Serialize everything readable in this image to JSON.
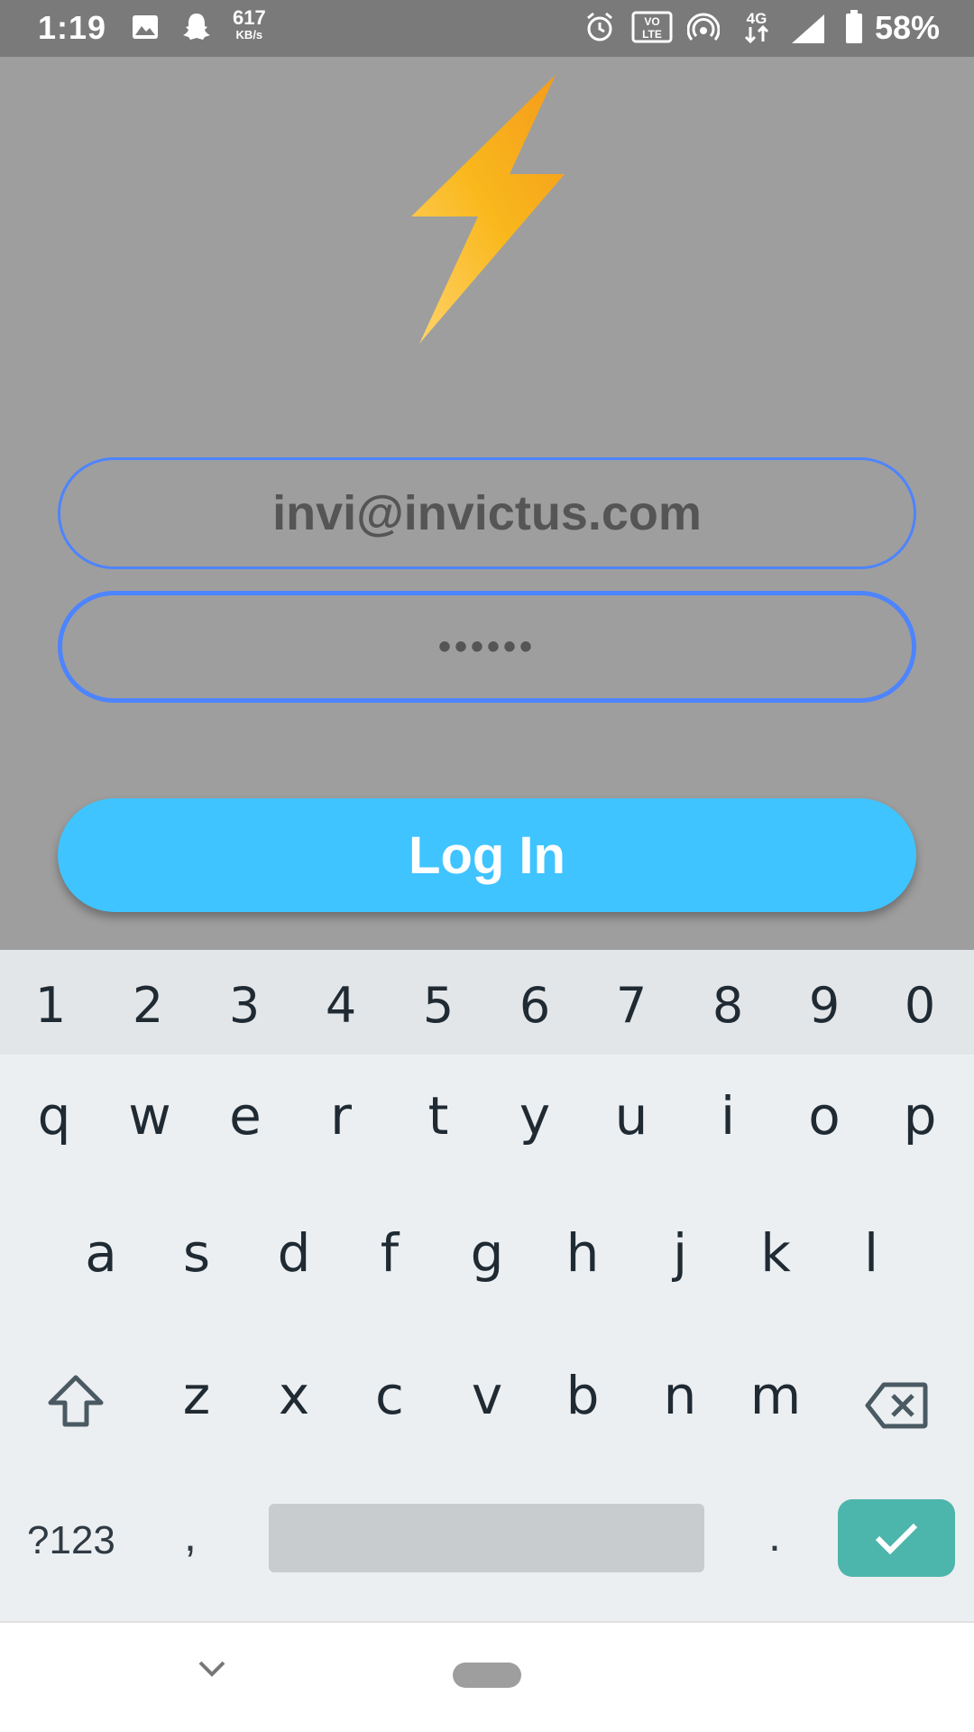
{
  "status_bar": {
    "time": "1:19",
    "speed_value": "617",
    "speed_unit": "KB/s",
    "network": "4G",
    "battery_percent": "58%"
  },
  "login_form": {
    "email_value": "invi@invictus.com",
    "password_value": "••••••",
    "login_label": "Log In"
  },
  "keyboard": {
    "number_row": [
      "1",
      "2",
      "3",
      "4",
      "5",
      "6",
      "7",
      "8",
      "9",
      "0"
    ],
    "row1": [
      "q",
      "w",
      "e",
      "r",
      "t",
      "y",
      "u",
      "i",
      "o",
      "p"
    ],
    "row2": [
      "a",
      "s",
      "d",
      "f",
      "g",
      "h",
      "j",
      "k",
      "l"
    ],
    "row3": [
      "z",
      "x",
      "c",
      "v",
      "b",
      "n",
      "m"
    ],
    "symbols_label": "?123",
    "comma_label": ",",
    "period_label": "."
  },
  "colors": {
    "accent_button": "#40c4ff",
    "field_border": "#4d84ff",
    "enter_key": "#4db6ac",
    "background": "#9e9e9e"
  },
  "icons": {
    "logo": "lightning-bolt-icon",
    "shift": "shift-arrow-icon",
    "backspace": "backspace-icon",
    "enter": "checkmark-icon",
    "nav_back": "chevron-down-icon"
  }
}
